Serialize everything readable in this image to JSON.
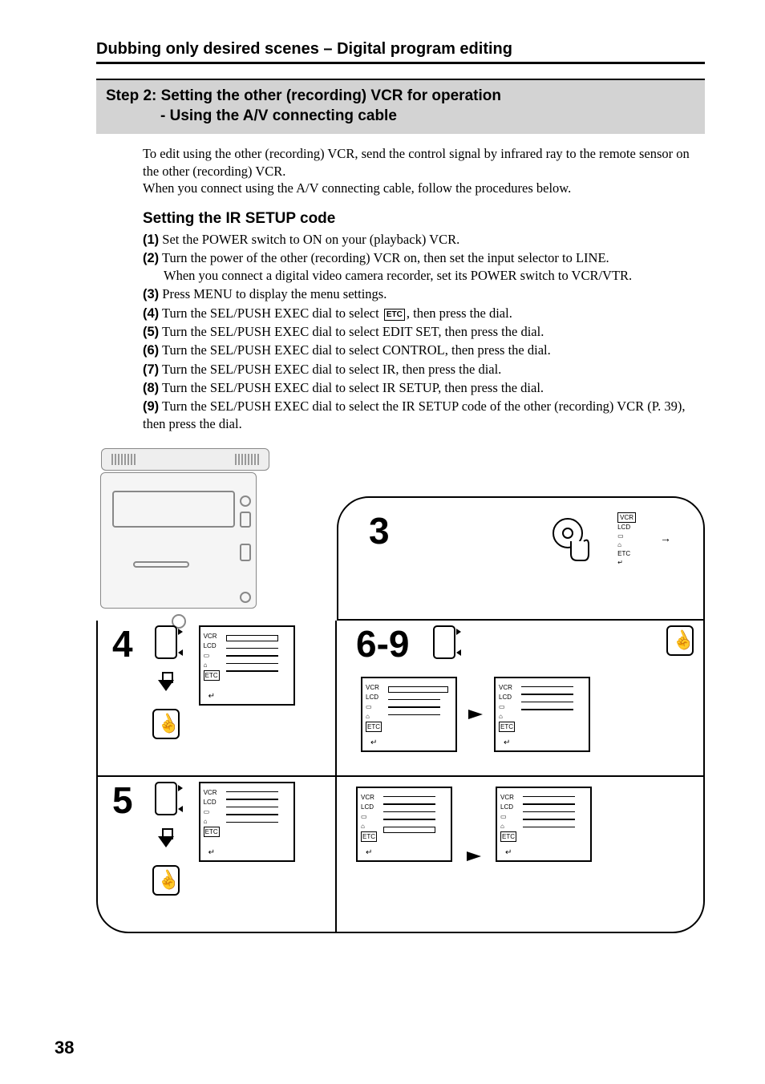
{
  "page_number": "38",
  "section_title": "Dubbing only desired scenes – Digital program editing",
  "step_header": {
    "line1": "Step 2: Setting the other (recording) VCR for operation",
    "line2": "- Using the A/V connecting cable"
  },
  "intro": {
    "p1": "To edit using the other (recording) VCR, send the control signal by infrared ray to the remote sensor on the other (recording) VCR.",
    "p2": "When you connect using the A/V connecting cable, follow the procedures below."
  },
  "subheading": "Setting the IR SETUP code",
  "steps": [
    {
      "bullet": "(1)",
      "text": "Set the POWER switch to ON on your (playback) VCR."
    },
    {
      "bullet": "(2)",
      "text": "Turn the power of the other (recording) VCR on, then set the input selector to LINE.",
      "cont": "When you connect a digital video camera recorder, set its POWER switch to VCR/VTR."
    },
    {
      "bullet": "(3)",
      "text": "Press MENU to display the menu settings."
    },
    {
      "bullet": "(4)",
      "text_pre": "Turn the SEL/PUSH EXEC dial to select ",
      "icon": "ETC",
      "text_post": ", then press the dial."
    },
    {
      "bullet": "(5)",
      "text": "Turn the SEL/PUSH EXEC dial to select EDIT SET, then press the dial."
    },
    {
      "bullet": "(6)",
      "text": "Turn the SEL/PUSH EXEC dial to select CONTROL, then press the dial."
    },
    {
      "bullet": "(7)",
      "text": "Turn the SEL/PUSH EXEC dial to select IR, then press the dial."
    },
    {
      "bullet": "(8)",
      "text": "Turn the SEL/PUSH EXEC dial to select IR SETUP, then press the dial."
    },
    {
      "bullet": "(9)",
      "text": "Turn the SEL/PUSH EXEC dial to select the IR SETUP code of the other (recording) VCR (P. 39), then press the dial."
    }
  ],
  "figure_labels": {
    "3": "3",
    "4": "4",
    "5": "5",
    "69": "6-9"
  },
  "menu": {
    "tabs": [
      "VCR",
      "LCD",
      "📼",
      "🔒",
      "ETC"
    ],
    "return_arrow": "↵"
  }
}
